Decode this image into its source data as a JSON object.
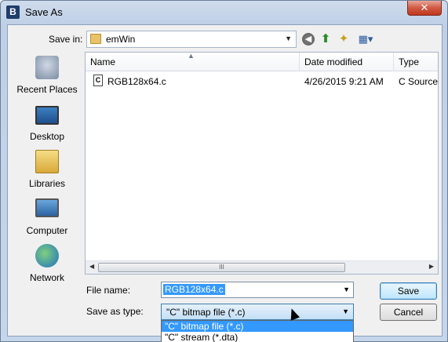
{
  "window": {
    "title": "Save As",
    "app_icon_letter": "B",
    "close_label": "✕"
  },
  "toolbar": {
    "save_in_label": "Save in:",
    "save_in_value": "emWin",
    "icons": [
      "back-icon",
      "up-folder-icon",
      "new-folder-icon",
      "views-icon"
    ]
  },
  "places": [
    {
      "label": "Recent Places",
      "icon": "recent-places-icon"
    },
    {
      "label": "Desktop",
      "icon": "desktop-icon"
    },
    {
      "label": "Libraries",
      "icon": "libraries-icon"
    },
    {
      "label": "Computer",
      "icon": "computer-icon"
    },
    {
      "label": "Network",
      "icon": "network-icon"
    }
  ],
  "filelist": {
    "columns": [
      "Name",
      "Date modified",
      "Type"
    ],
    "rows": [
      {
        "name": "RGB128x64.c",
        "date": "4/26/2015 9:21 AM",
        "type": "C Source f",
        "icon_letter": "C"
      }
    ],
    "scroll_grip": "III"
  },
  "form": {
    "file_name_label": "File name:",
    "file_name_value": "RGB128x64.c",
    "save_type_label": "Save as type:",
    "save_type_value": "\"C\" bitmap file (*.c)",
    "save_type_options": [
      "\"C\" bitmap file (*.c)",
      "\"C\" stream (*.dta)"
    ]
  },
  "buttons": {
    "save": "Save",
    "cancel": "Cancel"
  }
}
